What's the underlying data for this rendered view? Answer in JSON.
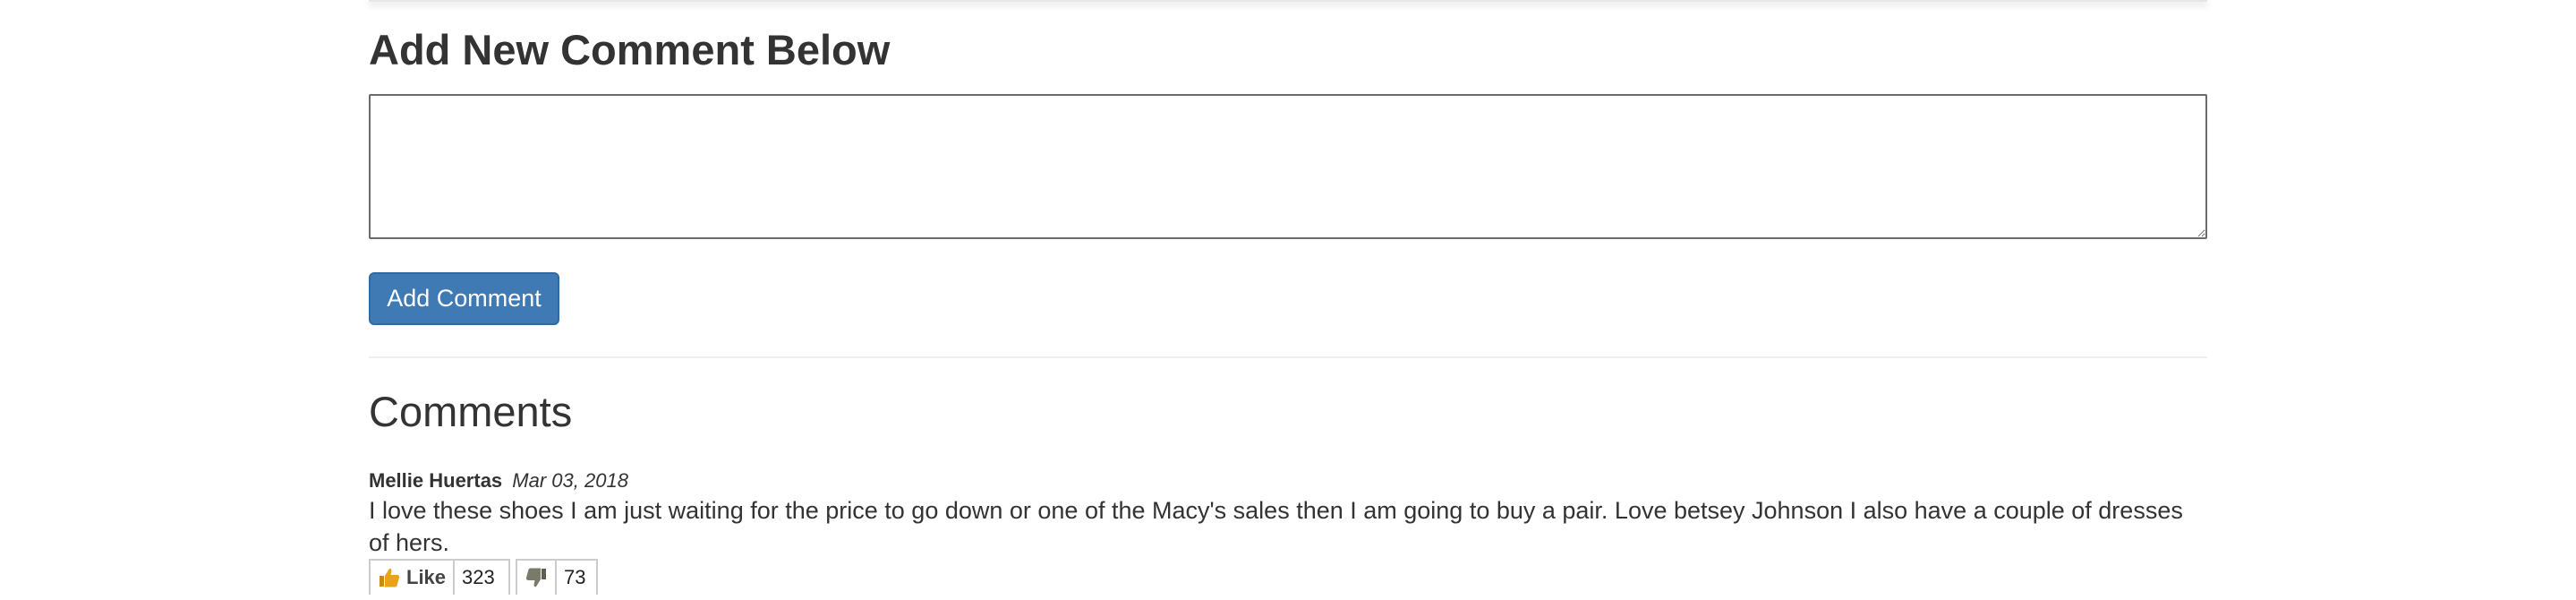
{
  "form": {
    "heading": "Add New Comment Below",
    "textarea_value": "",
    "submit_label": "Add Comment"
  },
  "comments_section": {
    "heading": "Comments",
    "items": [
      {
        "author": "Mellie Huertas",
        "date": "Mar 03, 2018",
        "text": "I love these shoes I am just waiting for the price to go down or one of the Macy's sales then I am going to buy a pair. Love betsey Johnson I also have a couple of dresses of hers.",
        "like_label": "Like",
        "like_count": "323",
        "dislike_count": "73",
        "like_icon": "thumbs-up-icon",
        "dislike_icon": "thumbs-down-icon"
      }
    ]
  },
  "colors": {
    "button_bg": "#3f7ab5",
    "text": "#333333",
    "thumb_up": "#e8a317",
    "thumb_down": "#7a7a6a"
  }
}
